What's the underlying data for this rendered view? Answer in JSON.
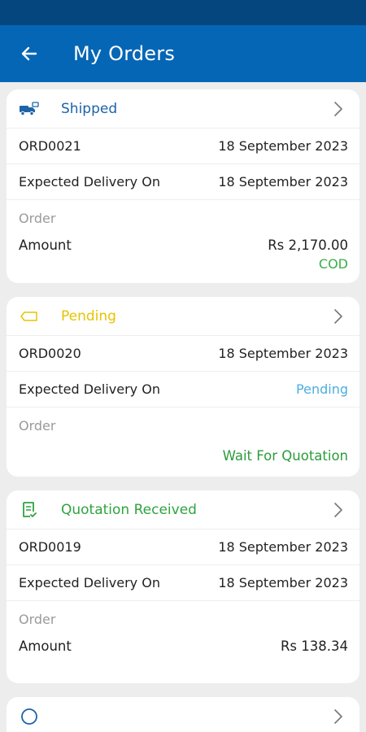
{
  "header": {
    "title": "My Orders"
  },
  "orders": [
    {
      "status": "Shipped",
      "order_id": "ORD0021",
      "order_date": "18 September 2023",
      "expected_label": "Expected Delivery On",
      "expected_value": "18 September 2023",
      "order_label": "Order",
      "amount_label": "Amount",
      "amount_value": "Rs 2,170.00",
      "payment": "COD"
    },
    {
      "status": "Pending",
      "order_id": "ORD0020",
      "order_date": "18 September 2023",
      "expected_label": "Expected Delivery On",
      "expected_value": "Pending",
      "order_label": "Order",
      "note": "Wait For Quotation"
    },
    {
      "status": "Quotation Received",
      "order_id": "ORD0019",
      "order_date": "18 September 2023",
      "expected_label": "Expected Delivery On",
      "expected_value": "18 September 2023",
      "order_label": "Order",
      "amount_label": "Amount",
      "amount_value": "Rs 138.34"
    }
  ],
  "colors": {
    "app_bar": "#0566b5",
    "status_bar": "#05467f",
    "shipped": "#1c63a8",
    "pending": "#e8c300",
    "quotation_received": "#2ea43e"
  }
}
